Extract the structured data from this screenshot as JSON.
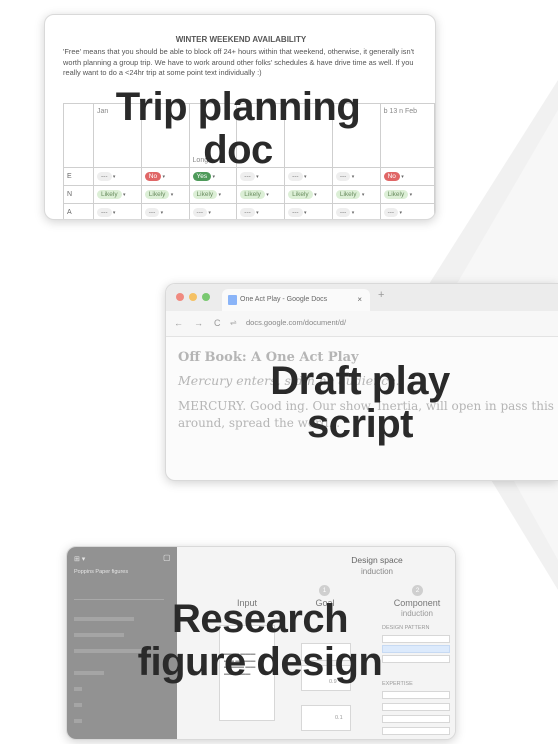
{
  "tiles": {
    "trip": {
      "overlay_title": "Trip planning doc"
    },
    "play": {
      "overlay_title_line1": "Draft play",
      "overlay_title_line2": "script"
    },
    "research": {
      "overlay_title_line1": "Research",
      "overlay_title_line2": "figure design"
    }
  },
  "trip_doc": {
    "heading": "WINTER WEEKEND AVAILABILITY",
    "note": "'Free' means that you should be able to block off 24+ hours within that weekend, otherwise, it generally isn't worth planning a group trip. We have to work around other folks' schedules & have drive time as well. If you really want to do a <24hr trip at some point text individually :)",
    "column_headers": [
      "Jan",
      "",
      "Long",
      "",
      "",
      "",
      "b 13 n Feb"
    ],
    "rows": [
      {
        "name": "E",
        "cells": [
          {
            "t": "---",
            "s": "gray"
          },
          {
            "t": "No",
            "s": "no"
          },
          {
            "t": "Yes",
            "s": "yes"
          },
          {
            "t": "---",
            "s": "gray"
          },
          {
            "t": "---",
            "s": "gray"
          },
          {
            "t": "---",
            "s": "gray"
          },
          {
            "t": "No",
            "s": "no"
          }
        ]
      },
      {
        "name": "N",
        "cells": [
          {
            "t": "Likely",
            "s": "likely"
          },
          {
            "t": "Likely",
            "s": "likely"
          },
          {
            "t": "Likely",
            "s": "likely"
          },
          {
            "t": "Likely",
            "s": "likely"
          },
          {
            "t": "Likely",
            "s": "likely"
          },
          {
            "t": "Likely",
            "s": "likely"
          },
          {
            "t": "Likely",
            "s": "likely"
          }
        ]
      },
      {
        "name": "A",
        "cells": [
          {
            "t": "---",
            "s": "gray"
          },
          {
            "t": "---",
            "s": "gray"
          },
          {
            "t": "---",
            "s": "gray"
          },
          {
            "t": "---",
            "s": "gray"
          },
          {
            "t": "---",
            "s": "gray"
          },
          {
            "t": "---",
            "s": "gray"
          },
          {
            "t": "---",
            "s": "gray"
          }
        ]
      }
    ]
  },
  "play_doc": {
    "tab_title": "One Act Play - Google Docs",
    "tab_close": "×",
    "new_tab": "+",
    "url": "docs.google.com/document/d/",
    "nav": {
      "back": "←",
      "forward": "→",
      "reload": "C"
    },
    "heading": "Off Book: A One Act Play",
    "stage_direction": "Mercury enters, s              din      he audience.",
    "body": "MERCURY. Good             ing. Our show, Inertia, will open in                pass this around, spread the word..."
  },
  "research_doc": {
    "sidebar_title": "Poppins Paper figures",
    "design_space_title": "Design space",
    "design_space_sub": "induction",
    "columns": [
      {
        "label": "Input",
        "num": ""
      },
      {
        "label": "Goal",
        "num": "1"
      },
      {
        "label": "Component",
        "num": "2",
        "sub": "induction"
      }
    ],
    "design_pattern_label": "DESIGN PATTERN",
    "expertise_label": "EXPERTISE",
    "score_a": "0.9",
    "score_b": "0.1"
  },
  "colors": {
    "chevron": "#f2f2f2",
    "overlay_text": "#2a2a2a",
    "pill_no": "#e06666",
    "pill_likely": "#dcefd6",
    "pill_yes": "#4e9a5a"
  }
}
